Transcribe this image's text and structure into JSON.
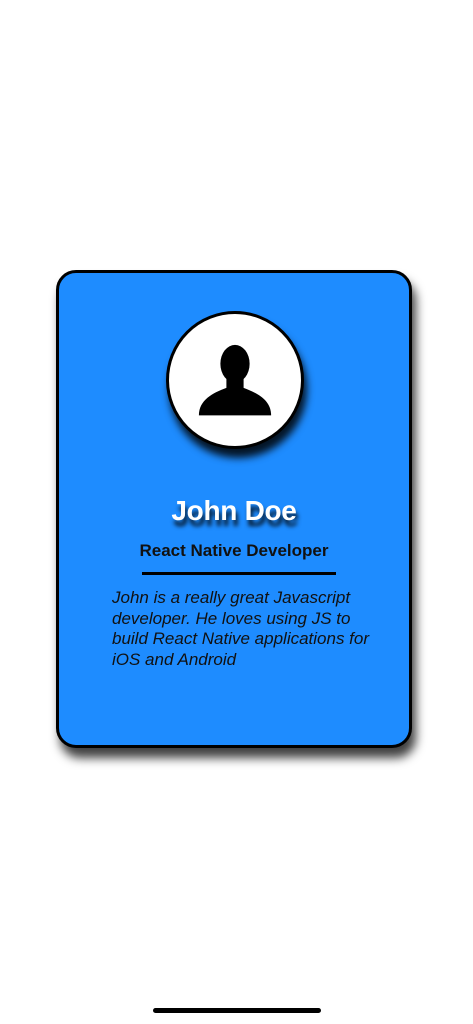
{
  "profile_card": {
    "name": "John Doe",
    "title": "React Native Developer",
    "bio": "John is a really great Javascript developer. He loves using JS to build React Native applications for iOS and Android",
    "avatar_icon": "person-silhouette-icon"
  },
  "colors": {
    "card_background": "#1e8cff",
    "border": "#000000",
    "name_text": "#ffffff"
  }
}
